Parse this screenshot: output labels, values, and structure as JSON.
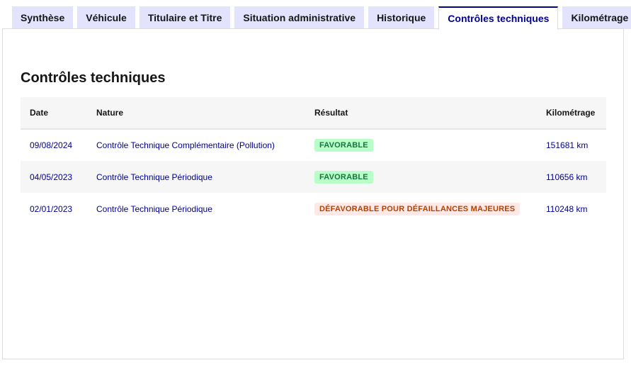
{
  "tabs": [
    {
      "label": "Synthèse",
      "active": false
    },
    {
      "label": "Véhicule",
      "active": false
    },
    {
      "label": "Titulaire et Titre",
      "active": false
    },
    {
      "label": "Situation administrative",
      "active": false
    },
    {
      "label": "Historique",
      "active": false
    },
    {
      "label": "Contrôles techniques",
      "active": true
    },
    {
      "label": "Kilométrage",
      "active": false
    }
  ],
  "section": {
    "title": "Contrôles techniques"
  },
  "table": {
    "headers": {
      "date": "Date",
      "nature": "Nature",
      "result": "Résultat",
      "mileage": "Kilométrage"
    },
    "rows": [
      {
        "date": "09/08/2024",
        "nature": "Contrôle Technique Complémentaire (Pollution)",
        "result": "FAVORABLE",
        "result_status": "success",
        "mileage": "151681 km"
      },
      {
        "date": "04/05/2023",
        "nature": "Contrôle Technique Périodique",
        "result": "FAVORABLE",
        "result_status": "success",
        "mileage": "110656 km"
      },
      {
        "date": "02/01/2023",
        "nature": "Contrôle Technique Périodique",
        "result": "DÉFAVORABLE POUR DÉFAILLANCES MAJEURES",
        "result_status": "error",
        "mileage": "110248 km"
      }
    ]
  },
  "colors": {
    "accent": "#000091",
    "tab_bg": "#e3e3fd",
    "success_bg": "#b8fec9",
    "success_text": "#18753c",
    "error_bg": "#ffe9e6",
    "error_text": "#b34000"
  }
}
